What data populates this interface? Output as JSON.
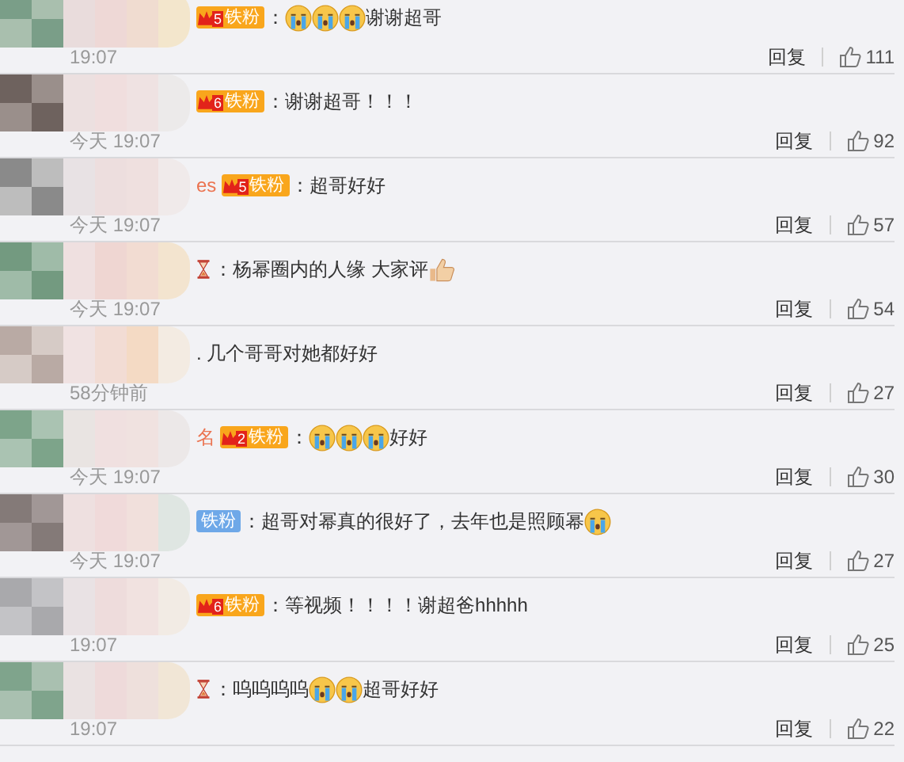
{
  "comments": [
    {
      "badge": {
        "kind": "orange",
        "level": "5",
        "label": "铁粉"
      },
      "content": [
        {
          "kind": "text",
          "text": "："
        },
        {
          "kind": "cry"
        },
        {
          "kind": "cry"
        },
        {
          "kind": "cry"
        },
        {
          "kind": "text",
          "text": "谢谢超哥"
        }
      ],
      "time": "19:07",
      "reply": "回复",
      "likes": "111"
    },
    {
      "badge": {
        "kind": "orange",
        "level": "6",
        "label": "铁粉"
      },
      "content": [
        {
          "kind": "text",
          "text": "：谢谢超哥！！！"
        }
      ],
      "time": "今天 19:07",
      "reply": "回复",
      "likes": "92"
    },
    {
      "name_tail": "es",
      "badge": {
        "kind": "orange",
        "level": "5",
        "label": "铁粉"
      },
      "content": [
        {
          "kind": "text",
          "text": "：超哥好好"
        }
      ],
      "time": "今天 19:07",
      "reply": "回复",
      "likes": "57"
    },
    {
      "content": [
        {
          "kind": "hourglass"
        },
        {
          "kind": "text",
          "text": "：杨幂圈内的人缘 大家评"
        },
        {
          "kind": "thumb"
        }
      ],
      "time": "今天 19:07",
      "reply": "回复",
      "likes": "54"
    },
    {
      "content": [
        {
          "kind": "text",
          "text": ". 几个哥哥对她都好好"
        }
      ],
      "time": "58分钟前",
      "reply": "回复",
      "likes": "27"
    },
    {
      "name_tail": "名",
      "badge": {
        "kind": "orange",
        "level": "2",
        "label": "铁粉"
      },
      "content": [
        {
          "kind": "text",
          "text": "："
        },
        {
          "kind": "cry"
        },
        {
          "kind": "cry"
        },
        {
          "kind": "cry"
        },
        {
          "kind": "text",
          "text": "好好"
        }
      ],
      "time": "今天 19:07",
      "reply": "回复",
      "likes": "30"
    },
    {
      "badge": {
        "kind": "blue",
        "label": "铁粉"
      },
      "content": [
        {
          "kind": "text",
          "text": "：超哥对幂真的很好了，去年也是照顾幂"
        },
        {
          "kind": "cry"
        }
      ],
      "time": "今天 19:07",
      "reply": "回复",
      "likes": "27"
    },
    {
      "badge": {
        "kind": "orange",
        "level": "6",
        "label": "铁粉"
      },
      "content": [
        {
          "kind": "text",
          "text": "：等视频！！！！谢超爸hhhhh"
        }
      ],
      "time": "19:07",
      "reply": "回复",
      "likes": "25"
    },
    {
      "content": [
        {
          "kind": "hourglass"
        },
        {
          "kind": "text",
          "text": "：呜呜呜呜"
        },
        {
          "kind": "cry"
        },
        {
          "kind": "cry"
        },
        {
          "kind": "text",
          "text": "超哥好好"
        }
      ],
      "time": "19:07",
      "reply": "回复",
      "likes": "22"
    }
  ]
}
